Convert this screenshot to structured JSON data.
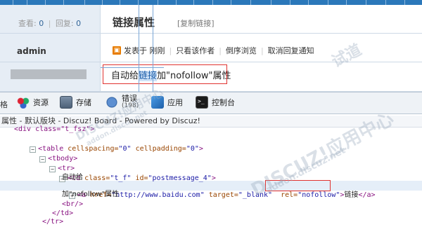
{
  "forum": {
    "views_label": "查看:",
    "views": "0",
    "sep": "|",
    "replies_label": "回复:",
    "replies": "0",
    "author": "admin",
    "title": "链接属性",
    "copy_link": "[复制链接]",
    "posted_icon": "poster-icon",
    "posted": "发表于 刚刚",
    "only_author": "只看该作者",
    "reverse": "倒序浏览",
    "cancel_notify": "取消回复通知",
    "content_pre": "自动给",
    "content_link": "链接",
    "content_post": "加\"nofollow\"属性"
  },
  "devtools": {
    "stub": "格",
    "tools": [
      {
        "label": "资源",
        "icon": "resources-icon"
      },
      {
        "label": "存储",
        "icon": "storage-icon"
      },
      {
        "label": "错误",
        "count": "(198)",
        "icon": "errors-icon"
      },
      {
        "label": "应用",
        "icon": "apps-icon"
      },
      {
        "label": "控制台",
        "icon": "console-icon"
      }
    ],
    "breadcrumb": "属性 - 默认版块 - Discuz! Board - Powered by Discuz!"
  },
  "dom": {
    "l0": "<div class=\"t_fsz\">",
    "l1_tag": "<table",
    "l1_attr1": " cellspacing=",
    "l1_val1": "\"0\"",
    "l1_attr2": " cellpadding=",
    "l1_val2": "\"0\"",
    "l1_end": ">",
    "l2": "<tbody>",
    "l3": "<tr>",
    "l4_tag": "<td",
    "l4_attr1": " class=",
    "l4_val1": "\"t_f\"",
    "l4_attr2": " id=",
    "l4_val2": "\"postmessage_4\"",
    "l4_end": ">",
    "l5": "自动给",
    "l6_tag": "<a",
    "l6_attr1": " href=",
    "l6_val1": "\"http://www.baidu.com\"",
    "l6_attr2": " target=",
    "l6_val2": "\"_blank\"",
    "l6_attr3": "rel=",
    "l6_val3": "\"nofollow\"",
    "l6_end": ">",
    "l6_text": "链接",
    "l6_close": "</a>",
    "l7": "加\"nofollow\"属性",
    "l8": "<br/>",
    "l9": "</td>",
    "l10": "</tr>"
  },
  "watermark": {
    "main": "DISCUZ!应用中心",
    "sub": "addon.discuz.net",
    "cn": "试道"
  },
  "colors": {
    "accent": "#2b78ba",
    "highlight": "#e0322f",
    "selection": "#e5eef8"
  }
}
